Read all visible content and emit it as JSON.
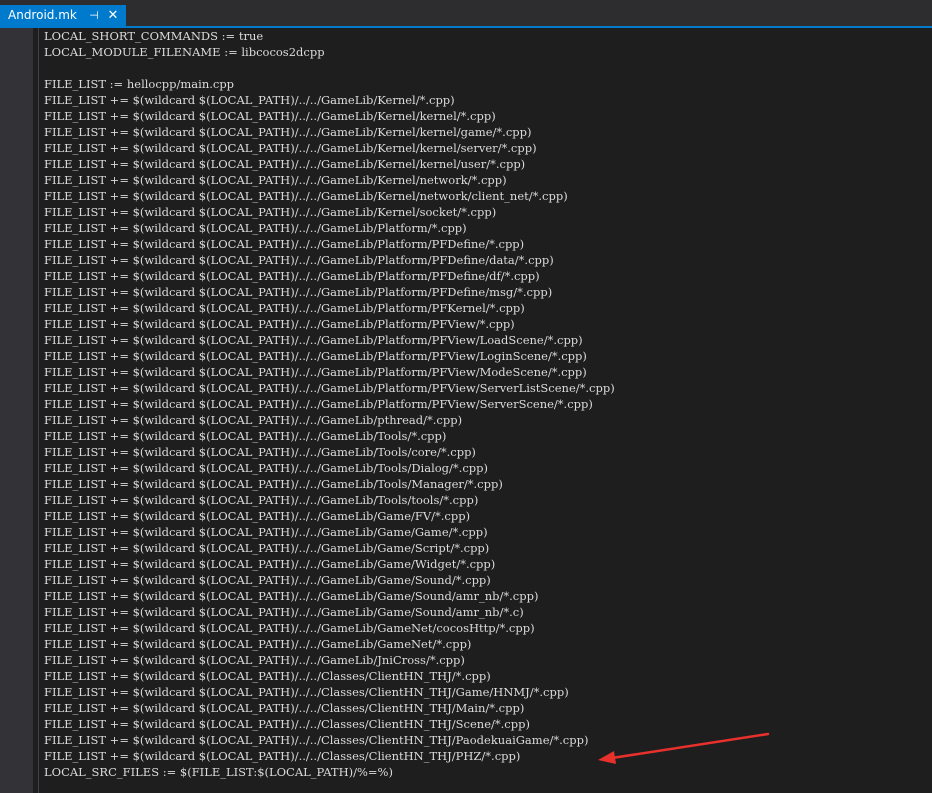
{
  "tab": {
    "title": "Android.mk",
    "pin_glyph": "⊣",
    "close_glyph": "✕"
  },
  "colors": {
    "editor_background": "#1e1e1e",
    "tab_active": "#007acc",
    "code_text": "#dcdcdc",
    "annotation_arrow": "#e8302c"
  },
  "annotation": {
    "type": "arrow-icon",
    "points_to_line": 47
  },
  "code_lines": [
    "LOCAL_SHORT_COMMANDS := true",
    "LOCAL_MODULE_FILENAME := libcocos2dcpp",
    "",
    "FILE_LIST := hellocpp/main.cpp",
    "FILE_LIST += $(wildcard $(LOCAL_PATH)/../../GameLib/Kernel/*.cpp)",
    "FILE_LIST += $(wildcard $(LOCAL_PATH)/../../GameLib/Kernel/kernel/*.cpp)",
    "FILE_LIST += $(wildcard $(LOCAL_PATH)/../../GameLib/Kernel/kernel/game/*.cpp)",
    "FILE_LIST += $(wildcard $(LOCAL_PATH)/../../GameLib/Kernel/kernel/server/*.cpp)",
    "FILE_LIST += $(wildcard $(LOCAL_PATH)/../../GameLib/Kernel/kernel/user/*.cpp)",
    "FILE_LIST += $(wildcard $(LOCAL_PATH)/../../GameLib/Kernel/network/*.cpp)",
    "FILE_LIST += $(wildcard $(LOCAL_PATH)/../../GameLib/Kernel/network/client_net/*.cpp)",
    "FILE_LIST += $(wildcard $(LOCAL_PATH)/../../GameLib/Kernel/socket/*.cpp)",
    "FILE_LIST += $(wildcard $(LOCAL_PATH)/../../GameLib/Platform/*.cpp)",
    "FILE_LIST += $(wildcard $(LOCAL_PATH)/../../GameLib/Platform/PFDefine/*.cpp)",
    "FILE_LIST += $(wildcard $(LOCAL_PATH)/../../GameLib/Platform/PFDefine/data/*.cpp)",
    "FILE_LIST += $(wildcard $(LOCAL_PATH)/../../GameLib/Platform/PFDefine/df/*.cpp)",
    "FILE_LIST += $(wildcard $(LOCAL_PATH)/../../GameLib/Platform/PFDefine/msg/*.cpp)",
    "FILE_LIST += $(wildcard $(LOCAL_PATH)/../../GameLib/Platform/PFKernel/*.cpp)",
    "FILE_LIST += $(wildcard $(LOCAL_PATH)/../../GameLib/Platform/PFView/*.cpp)",
    "FILE_LIST += $(wildcard $(LOCAL_PATH)/../../GameLib/Platform/PFView/LoadScene/*.cpp)",
    "FILE_LIST += $(wildcard $(LOCAL_PATH)/../../GameLib/Platform/PFView/LoginScene/*.cpp)",
    "FILE_LIST += $(wildcard $(LOCAL_PATH)/../../GameLib/Platform/PFView/ModeScene/*.cpp)",
    "FILE_LIST += $(wildcard $(LOCAL_PATH)/../../GameLib/Platform/PFView/ServerListScene/*.cpp)",
    "FILE_LIST += $(wildcard $(LOCAL_PATH)/../../GameLib/Platform/PFView/ServerScene/*.cpp)",
    "FILE_LIST += $(wildcard $(LOCAL_PATH)/../../GameLib/pthread/*.cpp)",
    "FILE_LIST += $(wildcard $(LOCAL_PATH)/../../GameLib/Tools/*.cpp)",
    "FILE_LIST += $(wildcard $(LOCAL_PATH)/../../GameLib/Tools/core/*.cpp)",
    "FILE_LIST += $(wildcard $(LOCAL_PATH)/../../GameLib/Tools/Dialog/*.cpp)",
    "FILE_LIST += $(wildcard $(LOCAL_PATH)/../../GameLib/Tools/Manager/*.cpp)",
    "FILE_LIST += $(wildcard $(LOCAL_PATH)/../../GameLib/Tools/tools/*.cpp)",
    "FILE_LIST += $(wildcard $(LOCAL_PATH)/../../GameLib/Game/FV/*.cpp)",
    "FILE_LIST += $(wildcard $(LOCAL_PATH)/../../GameLib/Game/Game/*.cpp)",
    "FILE_LIST += $(wildcard $(LOCAL_PATH)/../../GameLib/Game/Script/*.cpp)",
    "FILE_LIST += $(wildcard $(LOCAL_PATH)/../../GameLib/Game/Widget/*.cpp)",
    "FILE_LIST += $(wildcard $(LOCAL_PATH)/../../GameLib/Game/Sound/*.cpp)",
    "FILE_LIST += $(wildcard $(LOCAL_PATH)/../../GameLib/Game/Sound/amr_nb/*.cpp)",
    "FILE_LIST += $(wildcard $(LOCAL_PATH)/../../GameLib/Game/Sound/amr_nb/*.c)",
    "FILE_LIST += $(wildcard $(LOCAL_PATH)/../../GameLib/GameNet/cocosHttp/*.cpp)",
    "FILE_LIST += $(wildcard $(LOCAL_PATH)/../../GameLib/GameNet/*.cpp)",
    "FILE_LIST += $(wildcard $(LOCAL_PATH)/../../GameLib/JniCross/*.cpp)",
    "FILE_LIST += $(wildcard $(LOCAL_PATH)/../../Classes/ClientHN_THJ/*.cpp)",
    "FILE_LIST += $(wildcard $(LOCAL_PATH)/../../Classes/ClientHN_THJ/Game/HNMJ/*.cpp)",
    "FILE_LIST += $(wildcard $(LOCAL_PATH)/../../Classes/ClientHN_THJ/Main/*.cpp)",
    "FILE_LIST += $(wildcard $(LOCAL_PATH)/../../Classes/ClientHN_THJ/Scene/*.cpp)",
    "FILE_LIST += $(wildcard $(LOCAL_PATH)/../../Classes/ClientHN_THJ/PaodekuaiGame/*.cpp)",
    "FILE_LIST += $(wildcard $(LOCAL_PATH)/../../Classes/ClientHN_THJ/PHZ/*.cpp)",
    "LOCAL_SRC_FILES := $(FILE_LIST:$(LOCAL_PATH)/%=%)"
  ]
}
